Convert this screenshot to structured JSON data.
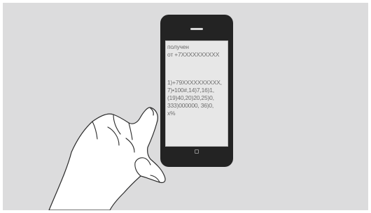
{
  "illustration": {
    "phone": {
      "sms": {
        "header_line1": "получен",
        "header_line2": "от +7XXXXXXXXXX",
        "body_lines": [
          "1)+79XXXXXXXXXX,",
          "7)•100#,14)7,16)1,",
          "(19)40,20)20,25)0,",
          "333)000000, 36)0,",
          "x%"
        ]
      },
      "home_button_icon": "square-icon"
    },
    "hand_icon": "pointing-hand-icon",
    "colors": {
      "background": "#dcdcdd",
      "phone_body": "#232323",
      "screen": "#e7e7e7",
      "sms_text": "#6e6e6e"
    }
  }
}
